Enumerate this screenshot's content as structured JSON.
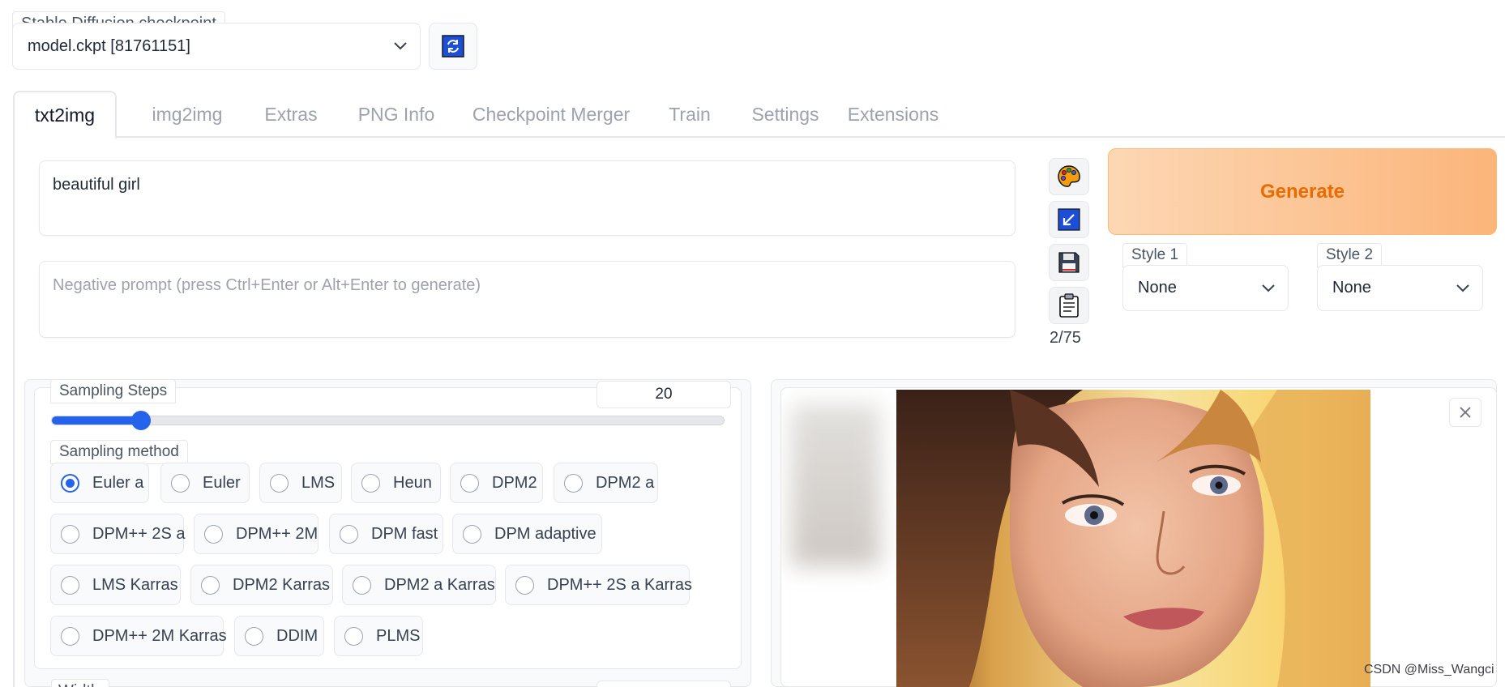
{
  "checkpoint": {
    "label": "Stable Diffusion checkpoint",
    "value": "model.ckpt [81761151]"
  },
  "tabs": [
    {
      "label": "txt2img",
      "active": true
    },
    {
      "label": "img2img"
    },
    {
      "label": "Extras"
    },
    {
      "label": "PNG Info"
    },
    {
      "label": "Checkpoint Merger"
    },
    {
      "label": "Train"
    },
    {
      "label": "Settings"
    },
    {
      "label": "Extensions"
    }
  ],
  "prompt": {
    "value": "beautiful girl"
  },
  "negative_prompt": {
    "placeholder": "Negative prompt (press Ctrl+Enter or Alt+Enter to generate)"
  },
  "tools": {
    "icons": [
      "palette-icon",
      "check-arrow-icon",
      "floppy-disk-icon",
      "clipboard-icon"
    ],
    "token_count": "2/75"
  },
  "generate": {
    "label": "Generate",
    "color": "#ea6b00"
  },
  "styles": {
    "style1": {
      "label": "Style 1",
      "value": "None"
    },
    "style2": {
      "label": "Style 2",
      "value": "None"
    }
  },
  "sampling_steps": {
    "label": "Sampling Steps",
    "value": "20",
    "slider_fraction": 0.134
  },
  "sampling_method": {
    "label": "Sampling method",
    "selected": "Euler a",
    "options": [
      "Euler a",
      "Euler",
      "LMS",
      "Heun",
      "DPM2",
      "DPM2 a",
      "DPM++ 2S a",
      "DPM++ 2M",
      "DPM fast",
      "DPM adaptive",
      "LMS Karras",
      "DPM2 Karras",
      "DPM2 a Karras",
      "DPM++ 2S a Karras",
      "DPM++ 2M Karras",
      "DDIM",
      "PLMS"
    ]
  },
  "width": {
    "label": "Width"
  },
  "output": {
    "close_icon": "close-icon",
    "image_alt": "generated portrait of a girl with long hair",
    "watermark": "CSDN @Miss_Wangci"
  },
  "colors": {
    "accent": "#2563eb",
    "generate_bg": "#fbb57a"
  }
}
